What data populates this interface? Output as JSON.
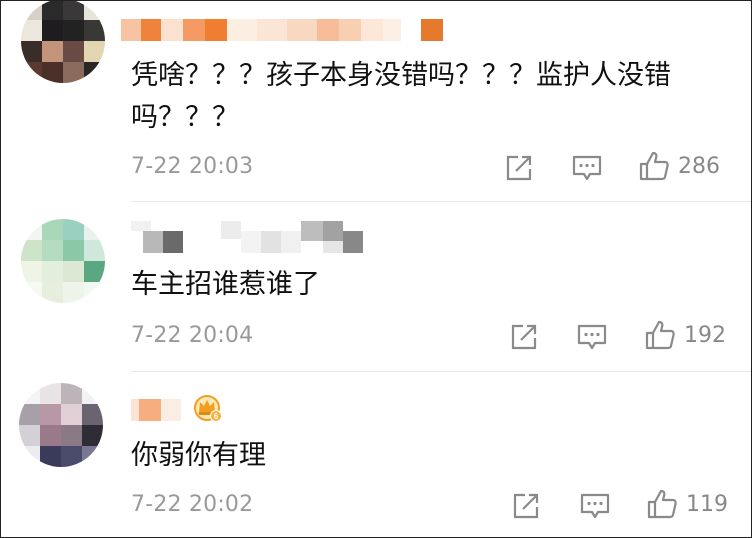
{
  "comments": [
    {
      "text": "凭啥？？？孩子本身没错吗？？？监护人没错吗？？？",
      "time": "7-22 20:03",
      "likes": "286"
    },
    {
      "text": "车主招谁惹谁了",
      "time": "7-22 20:04",
      "likes": "192"
    },
    {
      "text": "你弱你有理",
      "time": "7-22 20:02",
      "likes": "119"
    }
  ],
  "icons": {
    "share": "share-icon",
    "comment": "comment-icon",
    "like": "thumbs-up-icon",
    "badge": "crown-badge-icon"
  },
  "colors": {
    "text": "#111111",
    "meta": "#999999",
    "icon": "#8a8a8a",
    "badge": "#f0a020"
  }
}
